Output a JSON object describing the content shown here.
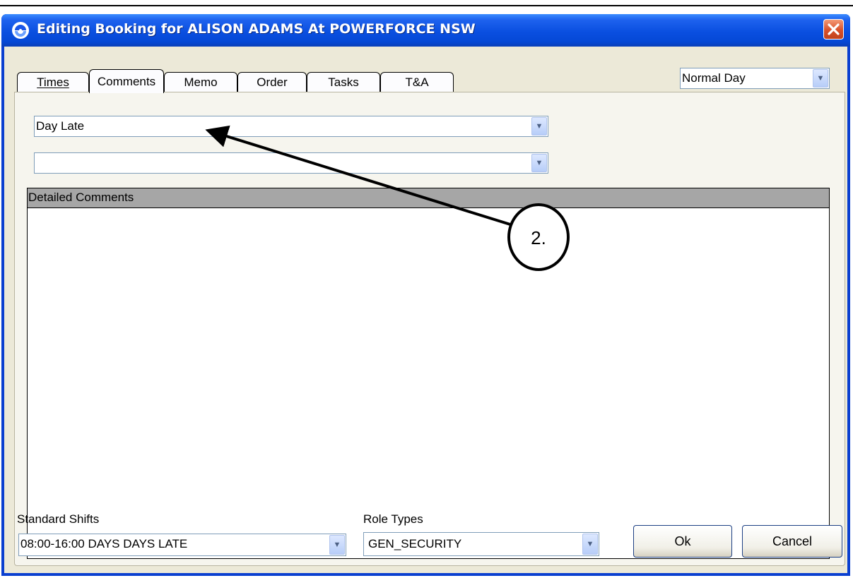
{
  "window": {
    "title": "Editing Booking for ALISON ADAMS At POWERFORCE NSW"
  },
  "tabs": [
    {
      "label": "Times",
      "active": false
    },
    {
      "label": "Comments",
      "active": true
    },
    {
      "label": "Memo",
      "active": false
    },
    {
      "label": "Order",
      "active": false
    },
    {
      "label": "Tasks",
      "active": false
    },
    {
      "label": "T&A",
      "active": false
    }
  ],
  "day_type": {
    "value": "Normal Day"
  },
  "comments": {
    "reason": "Day Late",
    "second": "",
    "detailed_header": "Detailed Comments",
    "detailed_text": ""
  },
  "footer": {
    "standard_shifts_label": "Standard Shifts",
    "standard_shifts_value": "08:00-16:00 DAYS DAYS LATE",
    "role_types_label": "Role Types",
    "role_types_value": "GEN_SECURITY",
    "ok_label": "Ok",
    "cancel_label": "Cancel"
  },
  "annotation": {
    "callout_label": "2."
  },
  "colors": {
    "titlebar": "#0a4fe0",
    "client": "#ece9d8",
    "close": "#d8502a",
    "header": "#a6a6a6"
  }
}
